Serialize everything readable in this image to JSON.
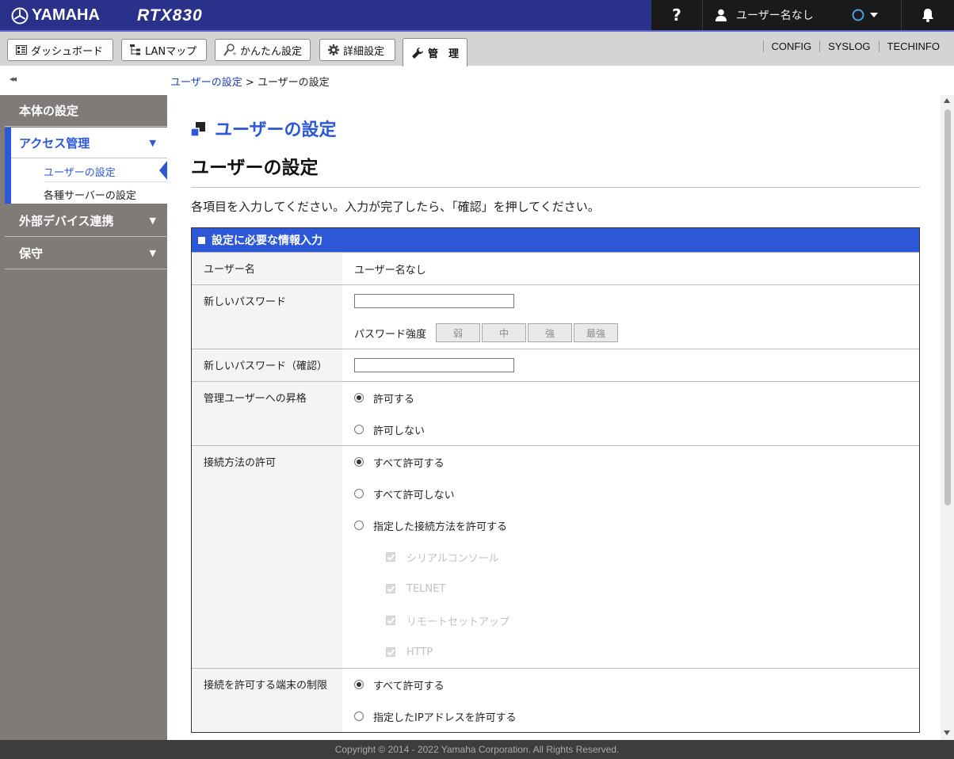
{
  "header": {
    "brand": "YAMAHA",
    "model": "RTX830",
    "help_label": "?",
    "user_name": "ユーザー名なし",
    "icons": {
      "brand": "yamaha-tuning-fork-icon",
      "user": "user-icon",
      "status": "status-ring-icon",
      "bell": "bell-icon"
    },
    "status_color": "#4aa3e6"
  },
  "tabs": [
    {
      "label": "ダッシュボード",
      "icon": "dashboard-icon"
    },
    {
      "label": "LANマップ",
      "icon": "lan-map-icon"
    },
    {
      "label": "かんたん設定",
      "icon": "wand-icon"
    },
    {
      "label": "詳細設定",
      "icon": "gear-icon"
    },
    {
      "label": "管　理",
      "icon": "wrench-icon",
      "active": true
    }
  ],
  "toplinks": [
    "CONFIG",
    "SYSLOG",
    "TECHINFO"
  ],
  "breadcrumb": {
    "link": "ユーザーの設定",
    "separator": ">",
    "current": "ユーザーの設定"
  },
  "sidebar": {
    "collapse_label": "◂◂",
    "sections": [
      {
        "label": "本体の設定"
      },
      {
        "label": "アクセス管理",
        "arrow": "▼",
        "items": [
          "ユーザーの設定",
          "各種サーバーの設定"
        ]
      },
      {
        "label": "外部デバイス連携",
        "arrow": "▼"
      },
      {
        "label": "保守",
        "arrow": "▼"
      }
    ]
  },
  "main": {
    "page_title": "ユーザーの設定",
    "sub_title": "ユーザーの設定",
    "instruction": "各項目を入力してください。入力が完了したら、「確認」を押してください。",
    "form": {
      "header": "設定に必要な情報入力",
      "username": {
        "label": "ユーザー名",
        "value": "ユーザー名なし"
      },
      "new_password": {
        "label": "新しいパスワード",
        "value": "",
        "strength_label": "パスワード強度",
        "strength_levels": [
          "弱",
          "中",
          "強",
          "最強"
        ]
      },
      "confirm_password": {
        "label": "新しいパスワード（確認）",
        "value": ""
      },
      "promotion": {
        "label": "管理ユーザーへの昇格",
        "options": [
          "許可する",
          "許可しない"
        ],
        "selected": 0
      },
      "connection": {
        "label": "接続方法の許可",
        "options": [
          "すべて許可する",
          "すべて許可しない",
          "指定した接続方法を許可する"
        ],
        "selected": 0,
        "methods": [
          "シリアルコンソール",
          "TELNET",
          "リモートセットアップ",
          "HTTP"
        ]
      },
      "terminal": {
        "label": "接続を許可する端末の制限",
        "options": [
          "すべて許可する",
          "指定したIPアドレスを許可する"
        ],
        "selected": 0
      }
    }
  },
  "footer": "Copyright © 2014 - 2022 Yamaha Corporation. All Rights Reserved.",
  "colors": {
    "topbar": "#29318a",
    "accent": "#2c57d6",
    "sidebar": "#807a78",
    "footer": "#3d3d3d"
  }
}
